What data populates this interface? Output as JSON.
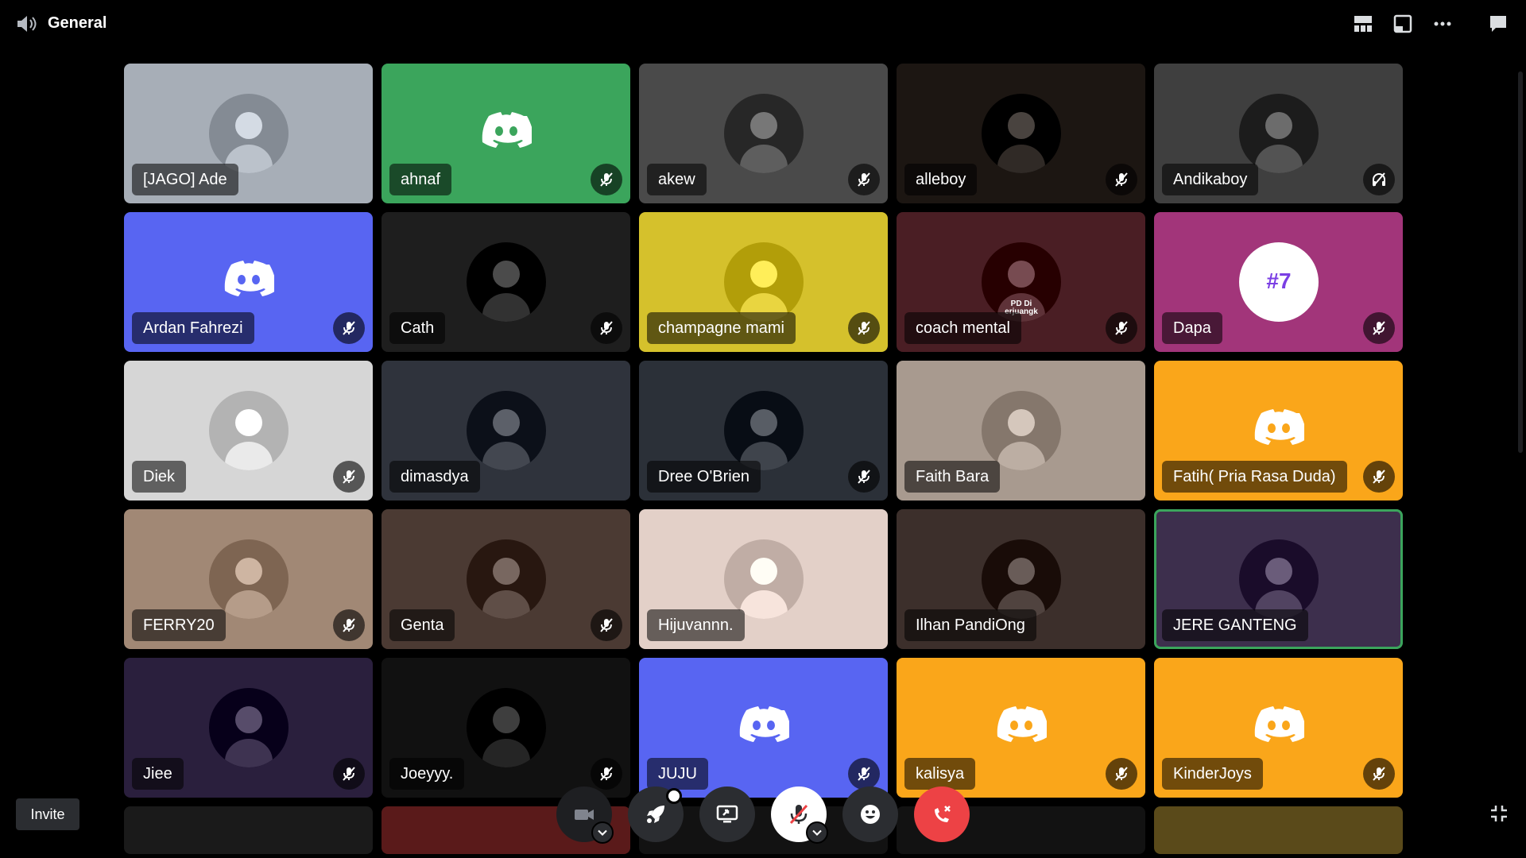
{
  "channel": {
    "title": "General",
    "icon": "speaker-icon"
  },
  "topbar_icons": [
    "grid-layout-icon",
    "popout-icon",
    "more-icon",
    "chat-icon"
  ],
  "colors": {
    "discord_blurple": "#5865f2",
    "speaking": "#3ba55c",
    "danger": "#ed4245"
  },
  "participants": [
    {
      "name": "[JAGO] Ade",
      "muted": false,
      "bg": "#a7aeb7",
      "avatar": "photo"
    },
    {
      "name": "ahnaf",
      "muted": true,
      "bg": "#3ba55c",
      "avatar": "discord-logo"
    },
    {
      "name": "akew",
      "muted": true,
      "bg": "#4a4a4a",
      "avatar": "photo"
    },
    {
      "name": "alleboy",
      "muted": true,
      "bg": "#1c1612",
      "avatar": "photo"
    },
    {
      "name": "Andikaboy",
      "muted": false,
      "deafened": true,
      "bg": "#3f3f3f",
      "avatar": "photo"
    },
    {
      "name": "Ardan Fahrezi",
      "muted": true,
      "bg": "#5865f2",
      "avatar": "discord-logo"
    },
    {
      "name": "Cath",
      "muted": true,
      "bg": "#1e1e1e",
      "avatar": "photo"
    },
    {
      "name": "champagne mami",
      "muted": true,
      "bg": "#d5c12c",
      "avatar": "photo"
    },
    {
      "name": "coach mental",
      "muted": true,
      "bg": "#4a1e24",
      "avatar": "photo",
      "avatar_text": [
        "PD Di",
        "erjuangk"
      ]
    },
    {
      "name": "Dapa",
      "muted": true,
      "bg": "#a2357a",
      "avatar": "photo",
      "avatar_text": [
        "#7"
      ]
    },
    {
      "name": "Diek",
      "muted": true,
      "bg": "#d6d6d6",
      "avatar": "photo"
    },
    {
      "name": "dimasdya",
      "muted": false,
      "bg": "#2f333c",
      "avatar": "photo"
    },
    {
      "name": "Dree O'Brien",
      "muted": true,
      "bg": "#2b3038",
      "avatar": "photo"
    },
    {
      "name": "Faith Bara",
      "muted": false,
      "bg": "#a89a8f",
      "avatar": "photo"
    },
    {
      "name": "Fatih( Pria Rasa Duda)",
      "muted": true,
      "bg": "#faa61a",
      "avatar": "discord-logo"
    },
    {
      "name": "FERRY20",
      "muted": true,
      "bg": "#a18875",
      "avatar": "photo"
    },
    {
      "name": "Genta",
      "muted": true,
      "bg": "#4b3a33",
      "avatar": "photo"
    },
    {
      "name": "Hijuvannn.",
      "muted": false,
      "bg": "#e3d0c8",
      "avatar": "photo"
    },
    {
      "name": "Ilhan PandiOng",
      "muted": false,
      "bg": "#3c2f2b",
      "avatar": "photo"
    },
    {
      "name": "JERE GANTENG",
      "muted": false,
      "speaking": true,
      "bg": "#3d2f4d",
      "avatar": "photo"
    },
    {
      "name": "Jiee",
      "muted": true,
      "bg": "#2a1f3d",
      "avatar": "photo"
    },
    {
      "name": "Joeyyy.",
      "muted": true,
      "bg": "#111111",
      "avatar": "photo"
    },
    {
      "name": "JUJU",
      "muted": true,
      "bg": "#5865f2",
      "avatar": "discord-logo"
    },
    {
      "name": "kalisya",
      "muted": true,
      "bg": "#faa61a",
      "avatar": "discord-logo"
    },
    {
      "name": "KinderJoys",
      "muted": true,
      "bg": "#faa61a",
      "avatar": "discord-logo"
    }
  ],
  "partial_row_colors": [
    "#1a1a1a",
    "#5a1a1a",
    "#121212",
    "#121212",
    "#5a4a1a"
  ],
  "invite": {
    "label": "Invite"
  },
  "controls": [
    {
      "name": "camera-button",
      "icon": "camera-off-icon",
      "dropdown": true
    },
    {
      "name": "activity-button",
      "icon": "rocket-icon"
    },
    {
      "name": "screen-share-button",
      "icon": "screen-share-icon"
    },
    {
      "name": "mute-button",
      "icon": "mic-muted-icon",
      "dropdown": true
    },
    {
      "name": "soundboard-button",
      "icon": "emoji-icon"
    },
    {
      "name": "disconnect-button",
      "icon": "hangup-icon"
    }
  ]
}
